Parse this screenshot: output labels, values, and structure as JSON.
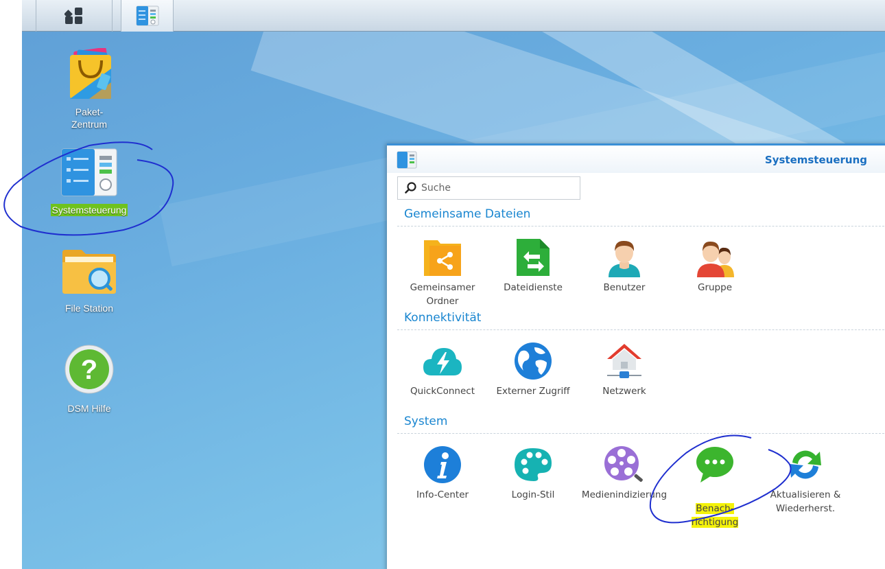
{
  "desktop": {
    "icons": [
      {
        "label": "Paket-\nZentrum",
        "line1": "Paket-",
        "line2": "Zentrum"
      },
      {
        "label": "Systemsteuerung"
      },
      {
        "label": "File Station"
      },
      {
        "label": "DSM Hilfe"
      }
    ]
  },
  "taskbar": {
    "main_menu_icon": "grid-menu-icon",
    "open_app_icon": "control-panel-icon"
  },
  "window": {
    "title": "Systemsteuerung",
    "search_placeholder": "Suche",
    "sections": [
      {
        "title": "Gemeinsame Dateien",
        "items": [
          {
            "label": "Gemeinsamer\nOrdner",
            "icon": "shared-folder-icon"
          },
          {
            "label": "Dateidienste",
            "icon": "file-services-icon"
          },
          {
            "label": "Benutzer",
            "icon": "user-icon"
          },
          {
            "label": "Gruppe",
            "icon": "group-icon"
          }
        ]
      },
      {
        "title": "Konnektivität",
        "items": [
          {
            "label": "QuickConnect",
            "icon": "quickconnect-icon"
          },
          {
            "label": "Externer Zugriff",
            "icon": "globe-icon"
          },
          {
            "label": "Netzwerk",
            "icon": "network-house-icon"
          }
        ]
      },
      {
        "title": "System",
        "items": [
          {
            "label": "Info-Center",
            "icon": "info-icon"
          },
          {
            "label": "Login-Stil",
            "icon": "palette-icon"
          },
          {
            "label": "Medienindizierung",
            "icon": "media-indexing-icon"
          },
          {
            "label": "Benach-\nrichtigung",
            "line1": "Benach-",
            "line2": "richtigung",
            "icon": "chat-bubble-icon"
          },
          {
            "label": "Aktualisieren &\nWiederherst.",
            "icon": "refresh-icon"
          }
        ]
      }
    ]
  },
  "colors": {
    "accent": "#1a86d0",
    "highlight_green": "#6fc21d",
    "highlight_yellow": "#f4f20a",
    "annotation_ink": "#1f2fcf"
  }
}
